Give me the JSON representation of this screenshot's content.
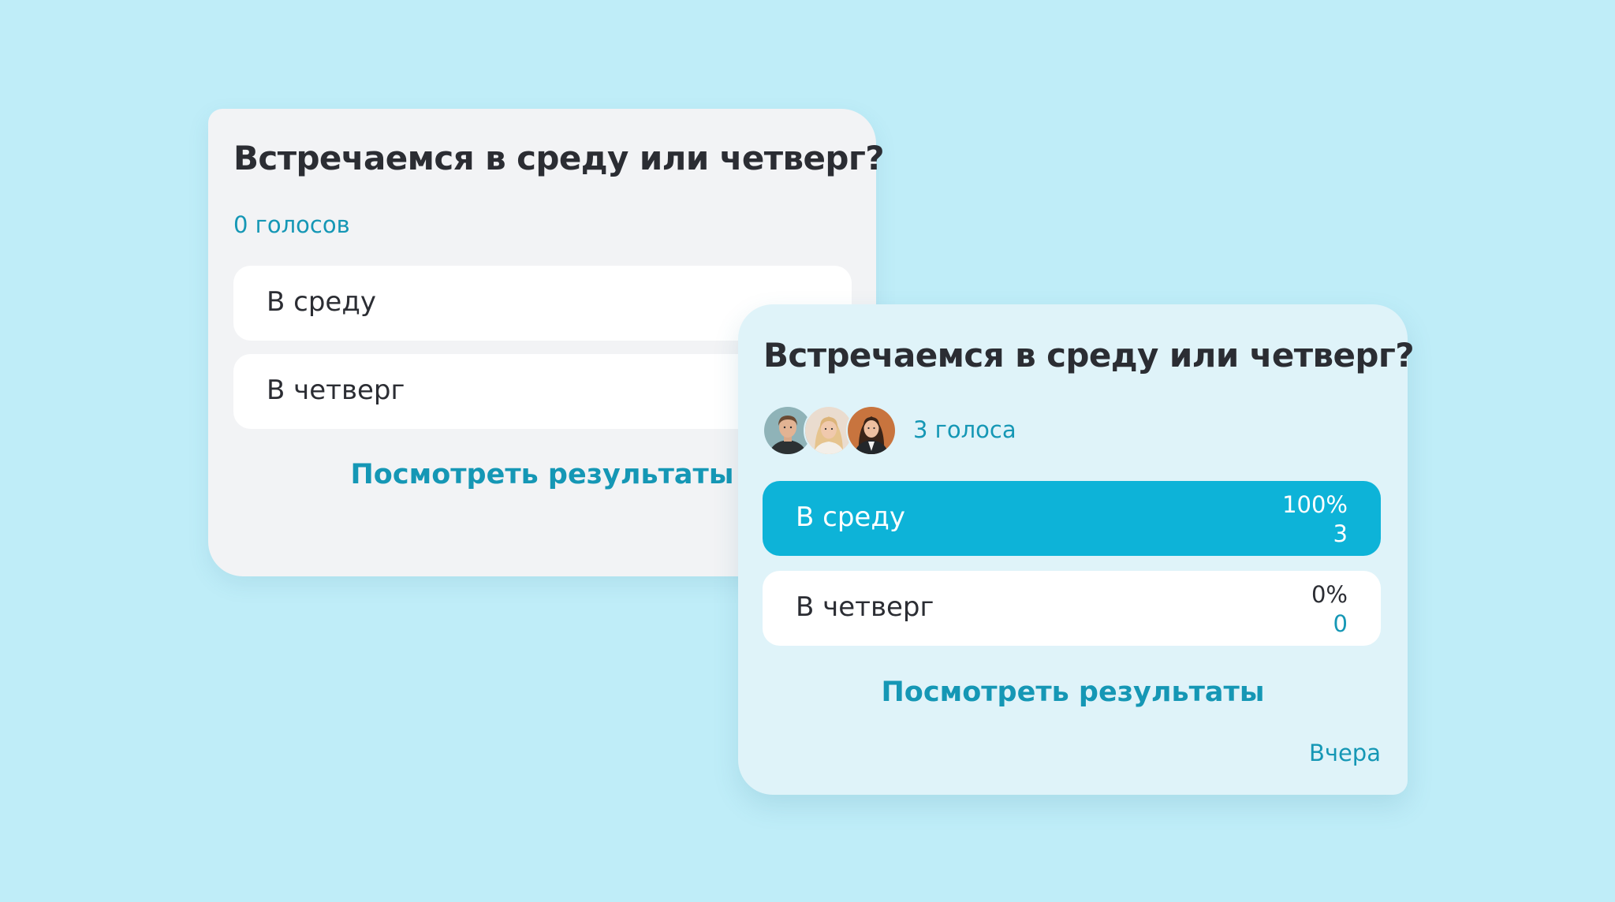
{
  "poll_before": {
    "question": "Встречаемся в среду или четверг?",
    "votes_label": "0 голосов",
    "options": [
      {
        "label": "В среду"
      },
      {
        "label": "В четверг"
      }
    ],
    "results_link": "Посмотреть результаты"
  },
  "poll_after": {
    "question": "Встречаемся в среду или четверг?",
    "voter_avatars": [
      "avatar-man-short-hair",
      "avatar-woman-blonde",
      "avatar-woman-dark-hair"
    ],
    "votes_label": "3 голоса",
    "options": [
      {
        "label": "В среду",
        "percent": "100%",
        "count": "3",
        "share": 1.0,
        "selected": true
      },
      {
        "label": "В четверг",
        "percent": "0%",
        "count": "0",
        "share": 0.0,
        "selected": false
      }
    ],
    "results_link": "Посмотреть результаты",
    "timestamp": "Вчера"
  },
  "colors": {
    "background": "#bfedf8",
    "accent": "#1597b5",
    "selected_option": "#0db3d8",
    "card_light": "#f2f3f5",
    "card_tinted": "#dff3f9"
  }
}
